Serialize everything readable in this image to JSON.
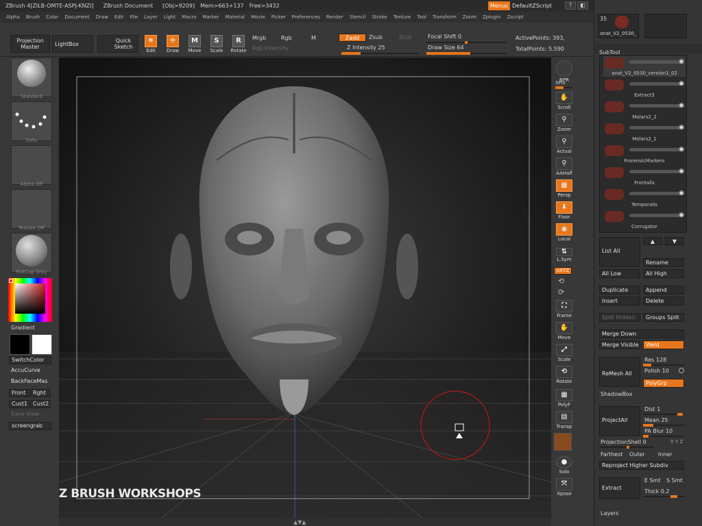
{
  "titlebar": {
    "app": "ZBrush 4[ZILB-OMTE-ASPJ-KNZI]",
    "doc": "ZBrush Document",
    "obj": "[Obj>9209]",
    "mem": "Mem>663+137",
    "free": "Free>3432",
    "menus_label": "Menus",
    "script_label": "DefaultZScript"
  },
  "menubar": [
    "Alpha",
    "Brush",
    "Color",
    "Document",
    "Draw",
    "Edit",
    "File",
    "Layer",
    "Light",
    "Macro",
    "Marker",
    "Material",
    "Movie",
    "Picker",
    "Preferences",
    "Render",
    "Stencil",
    "Stroke",
    "Texture",
    "Tool",
    "Transform",
    "Zoom",
    "Zplugin",
    "Zscript"
  ],
  "toolbar": {
    "projection_master": "Projection Master",
    "lightbox": "LightBox",
    "quick_sketch": "Quick Sketch",
    "edit": "Edit",
    "draw": "Draw",
    "move": "Move",
    "scale": "Scale",
    "rotate": "Rotate",
    "mrgb": "Mrgb",
    "rgb": "Rgb",
    "m": "M",
    "rgb_intensity": "Rgb Intensity",
    "zadd": "Zadd",
    "zsub": "Zsub",
    "zcut": "Zcut",
    "z_intensity_label": "Z Intensity",
    "z_intensity_value": "25",
    "z_intensity_pct": 25,
    "focal_shift_label": "Focal Shift",
    "focal_shift_value": "0",
    "draw_size_label": "Draw Size",
    "draw_size_value": "64",
    "active_points_label": "ActivePoints:",
    "active_points_value": "393,",
    "total_points_label": "TotalPoints:",
    "total_points_value": "5.590"
  },
  "left_shelf": {
    "standard": "Standard",
    "dots": "Dots",
    "alpha_off": "Alpha Off",
    "texture_off": "Texture Off",
    "matcap_gray": "MatCap Gray",
    "gradient": "Gradient",
    "switchcolor": "SwitchColor",
    "accucurve": "AccuCurve",
    "backfacemask": "BackFaceMas",
    "front": "Front",
    "right": "Rght",
    "cust1": "Cust1",
    "cust2": "Cust2",
    "save_view": "Save View",
    "screengrab": "screengrab"
  },
  "viewport": {
    "watermark": "Z BRUSH WORKSHOPS"
  },
  "right_shelf": {
    "bpr": "BPR",
    "spix": "SPix",
    "scroll": "Scroll",
    "zoom": "Zoom",
    "actual": "Actual",
    "aahalf": "AAHalf",
    "persp": "Persp",
    "floor": "Floor",
    "local": "Local",
    "lsym": "L.Sym",
    "xyz": "oXYZ",
    "frame": "Frame",
    "move": "Move",
    "scale": "Scale",
    "rotate": "Rotate",
    "polyf": "PolyF",
    "transp": "Transp",
    "solo": "Solo",
    "xpose": "Xpose"
  },
  "tool_panel": {
    "tool_count": "35",
    "tool_name": "anat_V2_0530_",
    "subtool_header": "SubTool",
    "subtools": [
      {
        "name": "anat_V2_0530_version1_02"
      },
      {
        "name": "Extract3"
      },
      {
        "name": "Molars2_2"
      },
      {
        "name": "Molars2_1"
      },
      {
        "name": "FrorensicMarkers"
      },
      {
        "name": "Frontalis"
      },
      {
        "name": "Temporalis"
      },
      {
        "name": "Corrugator"
      }
    ],
    "list_all": "List All",
    "rename": "Rename",
    "all_low": "All Low",
    "all_high": "All High",
    "duplicate": "Duplicate",
    "append": "Append",
    "insert": "Insert",
    "delete": "Delete",
    "split_hidden": "Split Hidden",
    "groups_split": "Groups Split",
    "merge_down": "Merge Down",
    "merge_visible": "Merge Visible",
    "weld": "Weld",
    "remesh_all": "ReMesh All",
    "res_label": "Res",
    "res_value": "128",
    "polish_label": "Polish",
    "polish_value": "10",
    "polygrp": "PolyGrp",
    "shadowbox": "ShadowBox",
    "project_all": "ProjectAll",
    "dist_label": "Dist",
    "dist_value": "1",
    "mean_label": "Mean",
    "mean_value": "25",
    "pablur_label": "PA Blur",
    "pablur_value": "10",
    "projection_shell_label": "ProjectionShell",
    "projection_shell_value": "0",
    "xyz_small": "X Y Z",
    "farthest": "Farthest",
    "outer": "Outer",
    "inner": "Inner",
    "reproject": "Reproject Higher Subdiv",
    "extract": "Extract",
    "esmt": "E Smt",
    "ssmt": "S Smt",
    "thick_label": "Thick",
    "thick_value": "0.2",
    "layers": "Layers"
  },
  "colors": {
    "accent": "#e8761a",
    "bg": "#383838",
    "viewport": "#1a1a1a"
  }
}
